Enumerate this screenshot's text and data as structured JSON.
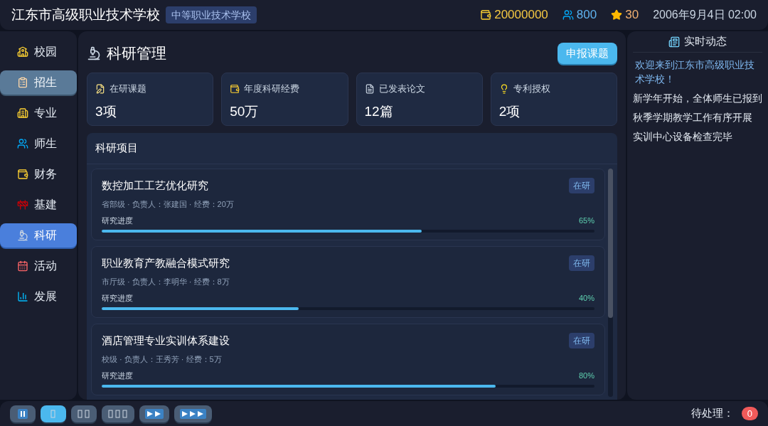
{
  "header": {
    "title": "江东市高级职业技术学校",
    "badge": "中等职业技术学校",
    "money": "20000000",
    "people": "800",
    "stars_count": "30",
    "datetime": "2006年9月4日 02:00"
  },
  "sidebar": {
    "items": [
      {
        "label": "校园",
        "selected": false,
        "hover": false
      },
      {
        "label": "招生",
        "selected": false,
        "hover": true
      },
      {
        "label": "专业",
        "selected": false,
        "hover": false
      },
      {
        "label": "师生",
        "selected": false,
        "hover": false
      },
      {
        "label": "财务",
        "selected": false,
        "hover": false
      },
      {
        "label": "基建",
        "selected": false,
        "hover": false
      },
      {
        "label": "科研",
        "selected": true,
        "hover": false
      },
      {
        "label": "活动",
        "selected": false,
        "hover": false
      },
      {
        "label": "发展",
        "selected": false,
        "hover": false
      }
    ]
  },
  "main": {
    "title": "科研管理",
    "action": "申报课题",
    "stats": [
      {
        "label": "在研课题",
        "value": "3项"
      },
      {
        "label": "年度科研经费",
        "value": "50万"
      },
      {
        "label": "已发表论文",
        "value": "12篇"
      },
      {
        "label": "专利授权",
        "value": "2项"
      }
    ],
    "section_title": "科研项目",
    "projects": [
      {
        "title": "数控加工工艺优化研究",
        "status": "在研",
        "meta": "省部级 · 负责人：张建国 · 经费：20万",
        "progress_label": "研究进度",
        "percent": "65%",
        "level": 0.65
      },
      {
        "title": "职业教育产教融合模式研究",
        "status": "在研",
        "meta": "市厅级 · 负责人：李明华 · 经费：8万",
        "progress_label": "研究进度",
        "percent": "40%",
        "level": 0.4
      },
      {
        "title": "酒店管理专业实训体系建设",
        "status": "在研",
        "meta": "校级 · 负责人：王秀芳 · 经费：5万",
        "progress_label": "研究进度",
        "percent": "80%",
        "level": 0.8
      }
    ]
  },
  "news": {
    "title": "实时动态",
    "items": [
      {
        "text": "欢迎来到江东市高级职业技术学校！",
        "highlighted": true
      },
      {
        "text": "新学年开始，全体师生已报到",
        "highlighted": false
      },
      {
        "text": "秋季学期教学工作有序开展",
        "highlighted": false
      },
      {
        "text": "实训中心设备检查完毕",
        "highlighted": false
      }
    ]
  },
  "footer": {
    "speeds": [
      {
        "kind": "pause",
        "selected": false
      },
      {
        "kind": "speed1",
        "selected": true
      },
      {
        "kind": "speed2",
        "selected": false
      },
      {
        "kind": "speed3",
        "selected": false
      },
      {
        "kind": "fast",
        "selected": false
      },
      {
        "kind": "fastest",
        "selected": false
      }
    ],
    "pending_label": "待处理：",
    "pending_count": "0"
  }
}
